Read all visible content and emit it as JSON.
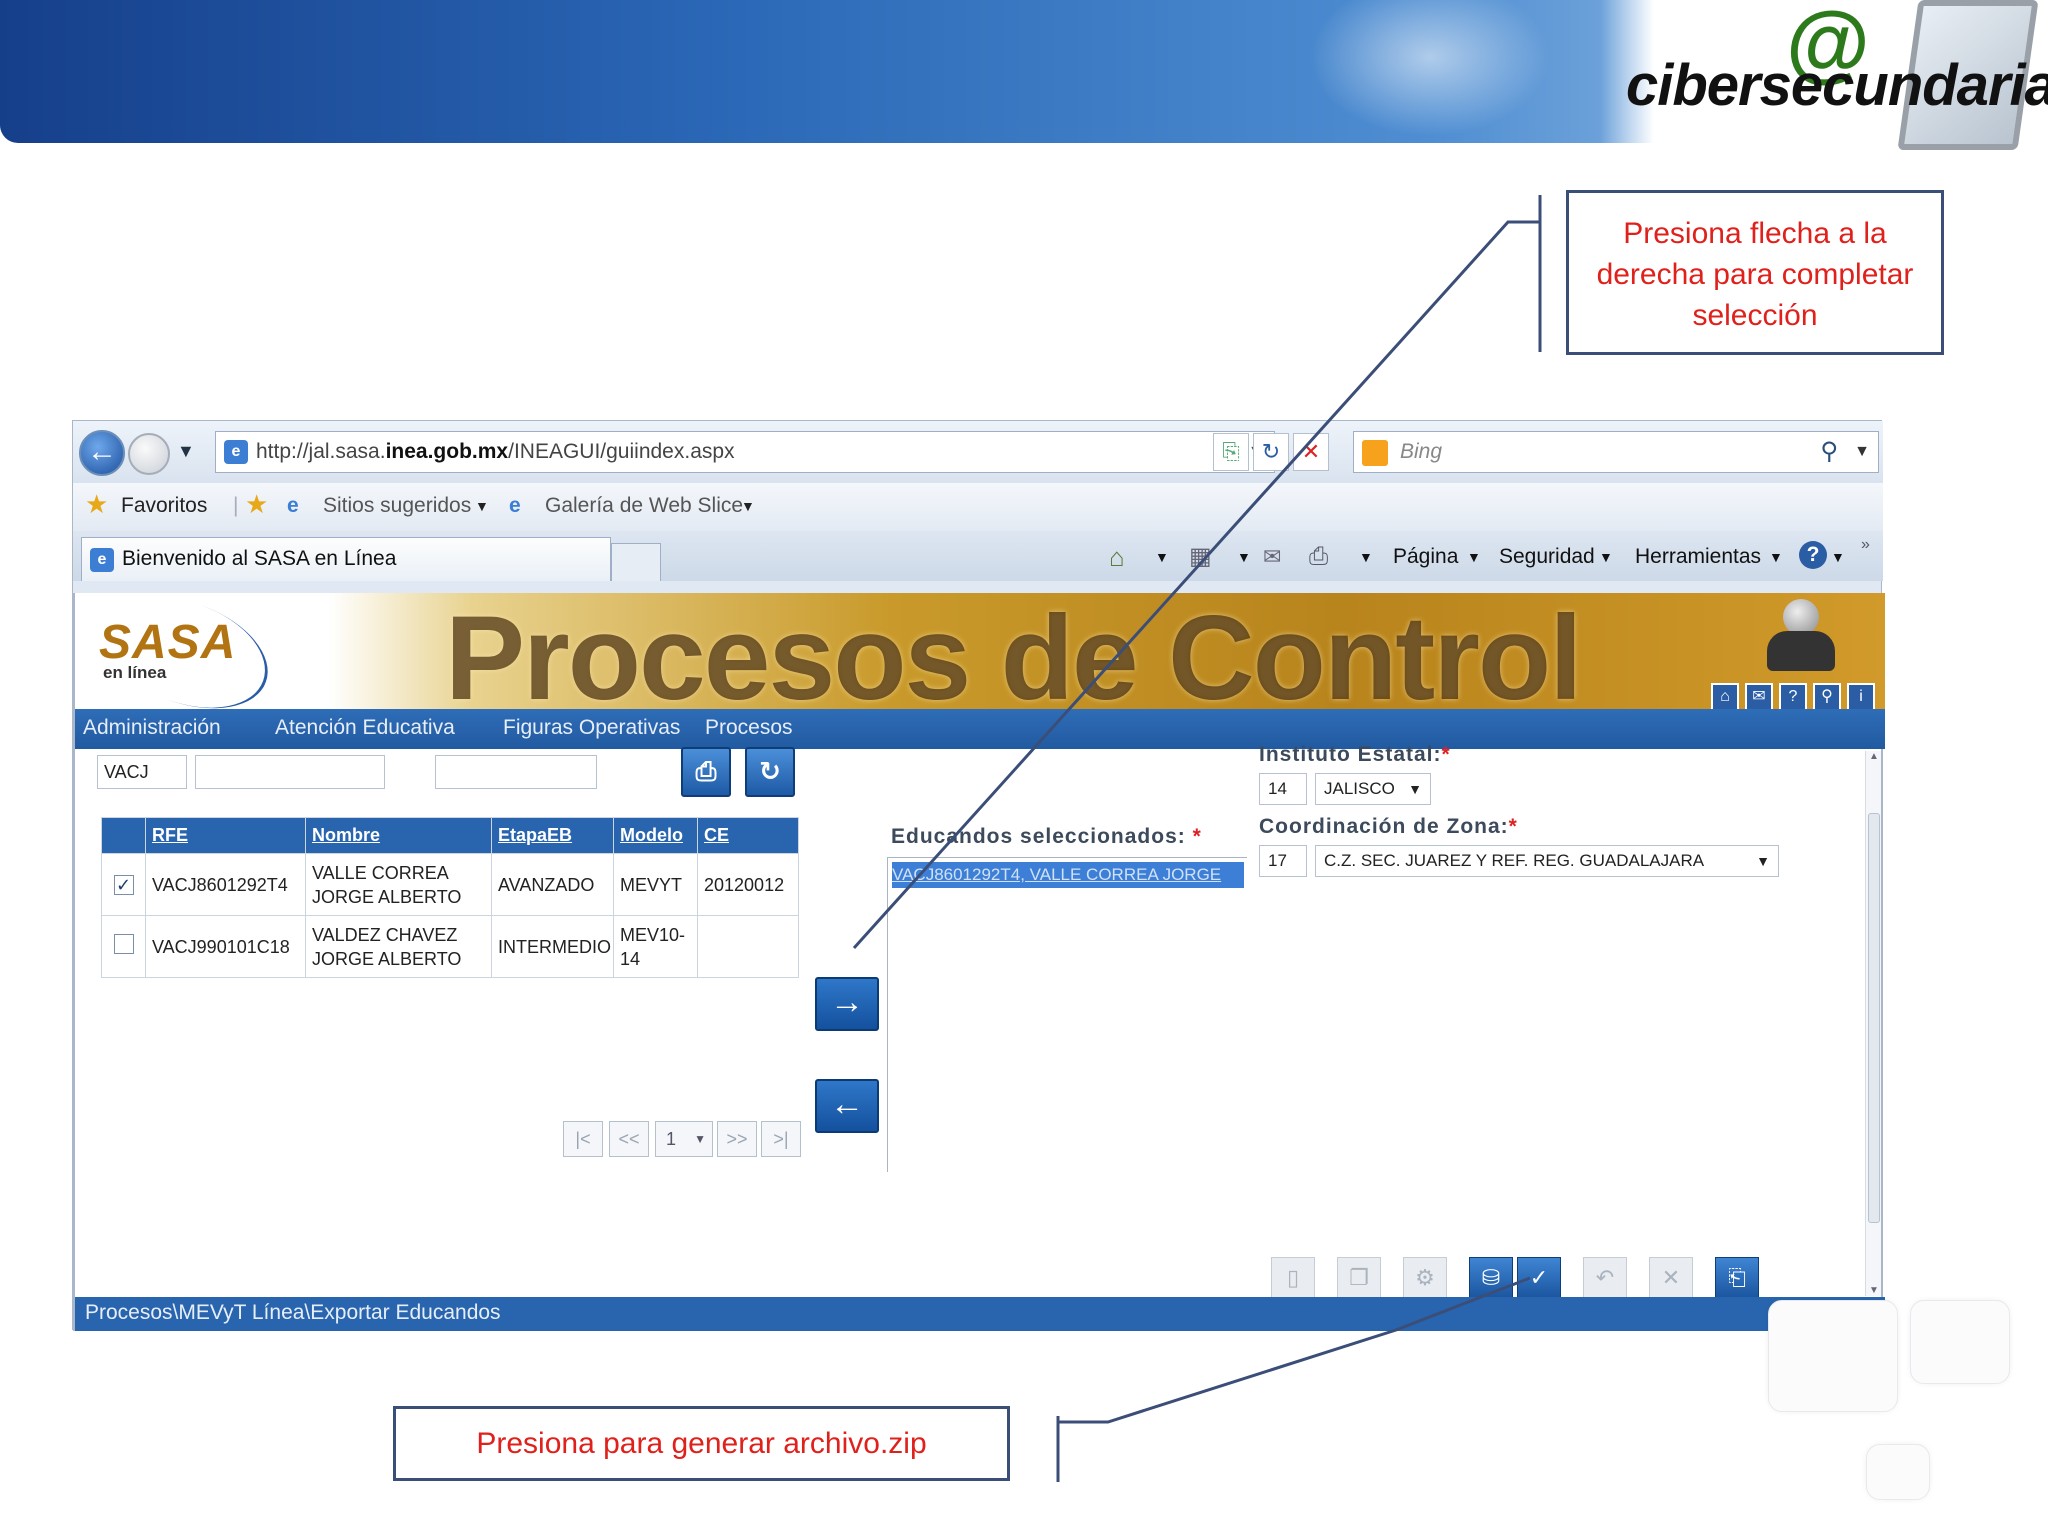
{
  "brand": {
    "at": "@",
    "name": "cibersecundaria"
  },
  "callouts": {
    "top": "Presiona flecha a la derecha para completar selección",
    "bottom": "Presiona para generar archivo.zip"
  },
  "browser": {
    "url_prefix": "http://jal.sasa.",
    "url_domain": "inea.gob.mx",
    "url_path": "/INEAGUI/guiindex.aspx",
    "search_placeholder": "Bing",
    "favorites": "Favoritos",
    "suggested_sites": "Sitios sugeridos",
    "web_slice": "Galería de Web Slice",
    "tab_title": "Bienvenido al SASA en Línea",
    "commands": {
      "page": "Página",
      "security": "Seguridad",
      "tools": "Herramientas"
    }
  },
  "app": {
    "logo": "SASA",
    "logo_sub": "en línea",
    "header_title": "Procesos de Control",
    "menu": [
      "Administración",
      "Atención Educativa",
      "Figuras Operativas",
      "Procesos"
    ],
    "search_fields": {
      "rfe": "VACJ",
      "name": "",
      "other": ""
    },
    "table": {
      "headers": [
        "RFE",
        "Nombre",
        "EtapaEB",
        "Modelo",
        "CE"
      ],
      "rows": [
        {
          "checked": true,
          "rfe": "VACJ8601292T4",
          "nombre_1": "VALLE CORREA",
          "nombre_2": "JORGE ALBERTO",
          "etapa": "AVANZADO",
          "modelo_1": "MEVYT",
          "modelo_2": "",
          "ce": "20120012"
        },
        {
          "checked": false,
          "rfe": "VACJ990101C18",
          "nombre_1": "VALDEZ CHAVEZ",
          "nombre_2": "JORGE ALBERTO",
          "etapa": "INTERMEDIO",
          "modelo_1": "MEV10-",
          "modelo_2": "14",
          "ce": ""
        }
      ]
    },
    "pager": {
      "first": "|<",
      "prev": "<<",
      "page": "1",
      "next": ">>",
      "last": ">|"
    },
    "selected_label": "Educandos seleccionados:",
    "selected_item": "VACJ8601292T4, VALLE CORREA JORGE",
    "instituto_label": "Instituto Estatal:",
    "instituto_code": "14",
    "instituto_value": "JALISCO",
    "coordinacion_label": "Coordinación de Zona:",
    "coordinacion_code": "17",
    "coordinacion_value": "C.Z. SEC. JUAREZ Y REF. REG. GUADALAJARA",
    "required_mark": "*",
    "status_path": "Procesos\\MEVyT Línea\\Exportar Educandos"
  },
  "icons": {
    "arrow_right": "→",
    "arrow_left": "←",
    "check": "✓"
  }
}
